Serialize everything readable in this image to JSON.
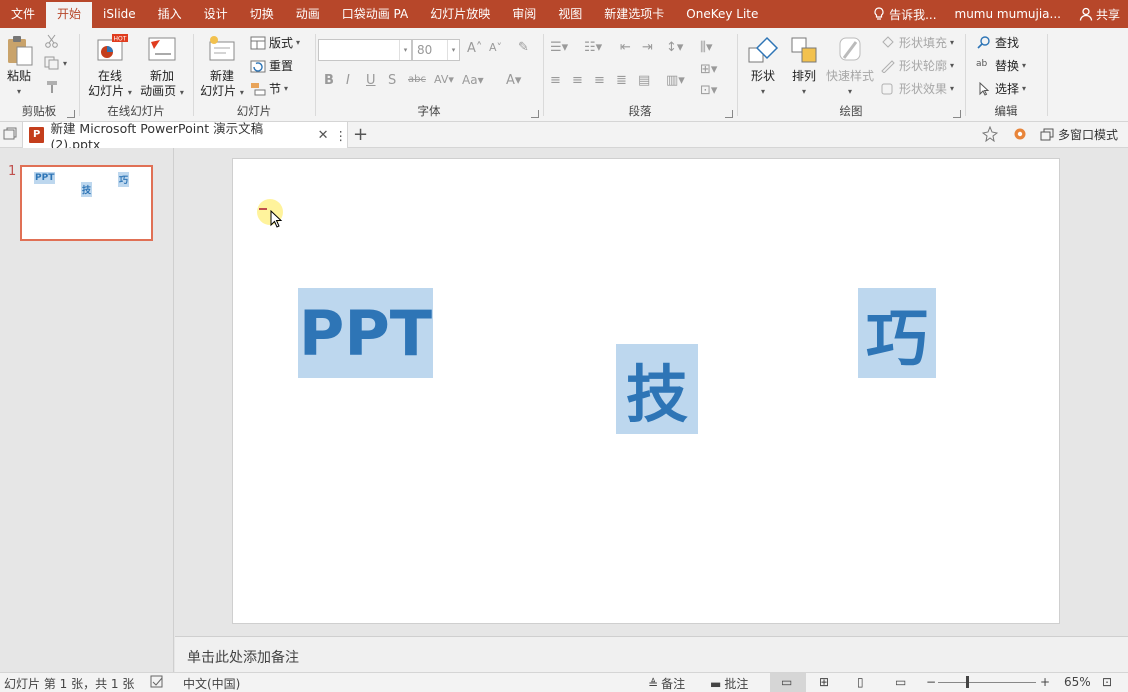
{
  "menu": {
    "tabs": [
      "文件",
      "开始",
      "iSlide",
      "插入",
      "设计",
      "切换",
      "动画",
      "口袋动画 PA",
      "幻灯片放映",
      "审阅",
      "视图",
      "新建选项卡",
      "OneKey Lite"
    ],
    "active": "开始",
    "tell_me": "告诉我...",
    "user": "mumu mumujia...",
    "share": "共享"
  },
  "ribbon": {
    "clipboard": {
      "paste": "粘贴",
      "group": "剪贴板"
    },
    "online": {
      "online_slides": "在线\n幻灯片",
      "online_l1": "在线",
      "online_l2": "幻灯片",
      "new_anim_l1": "新加",
      "new_anim_l2": "动画页",
      "hot": "HOT",
      "group": "在线幻灯片"
    },
    "slides": {
      "new_l1": "新建",
      "new_l2": "幻灯片",
      "layout": "版式",
      "reset": "重置",
      "section": "节",
      "group": "幻灯片"
    },
    "font": {
      "name_value": "",
      "size_value": "80",
      "group": "字体"
    },
    "paragraph": {
      "group": "段落"
    },
    "drawing": {
      "shapes": "形状",
      "arrange": "排列",
      "quick_styles": "快速样式",
      "fill": "形状填充",
      "outline": "形状轮廓",
      "effects": "形状效果",
      "group": "绘图"
    },
    "editing": {
      "find": "查找",
      "replace": "替换",
      "select": "选择",
      "group": "编辑"
    }
  },
  "doc_tab": {
    "title": "新建 Microsoft PowerPoint 演示文稿 (2).pptx",
    "multi_window": "多窗口模式"
  },
  "thumbnail": {
    "number": "1",
    "labels": [
      "PPT",
      "技",
      "巧"
    ]
  },
  "slide": {
    "words": [
      "PPT",
      "技",
      "巧"
    ]
  },
  "notes": {
    "placeholder": "单击此处添加备注"
  },
  "status": {
    "slide_info": "幻灯片 第 1 张，共 1 张",
    "language": "中文(中国)",
    "notes": "备注",
    "comments": "批注",
    "zoom": "65%"
  },
  "colors": {
    "accent": "#b7472a",
    "text_box_fill": "#bdd7ee",
    "text_color": "#2e75b6"
  }
}
